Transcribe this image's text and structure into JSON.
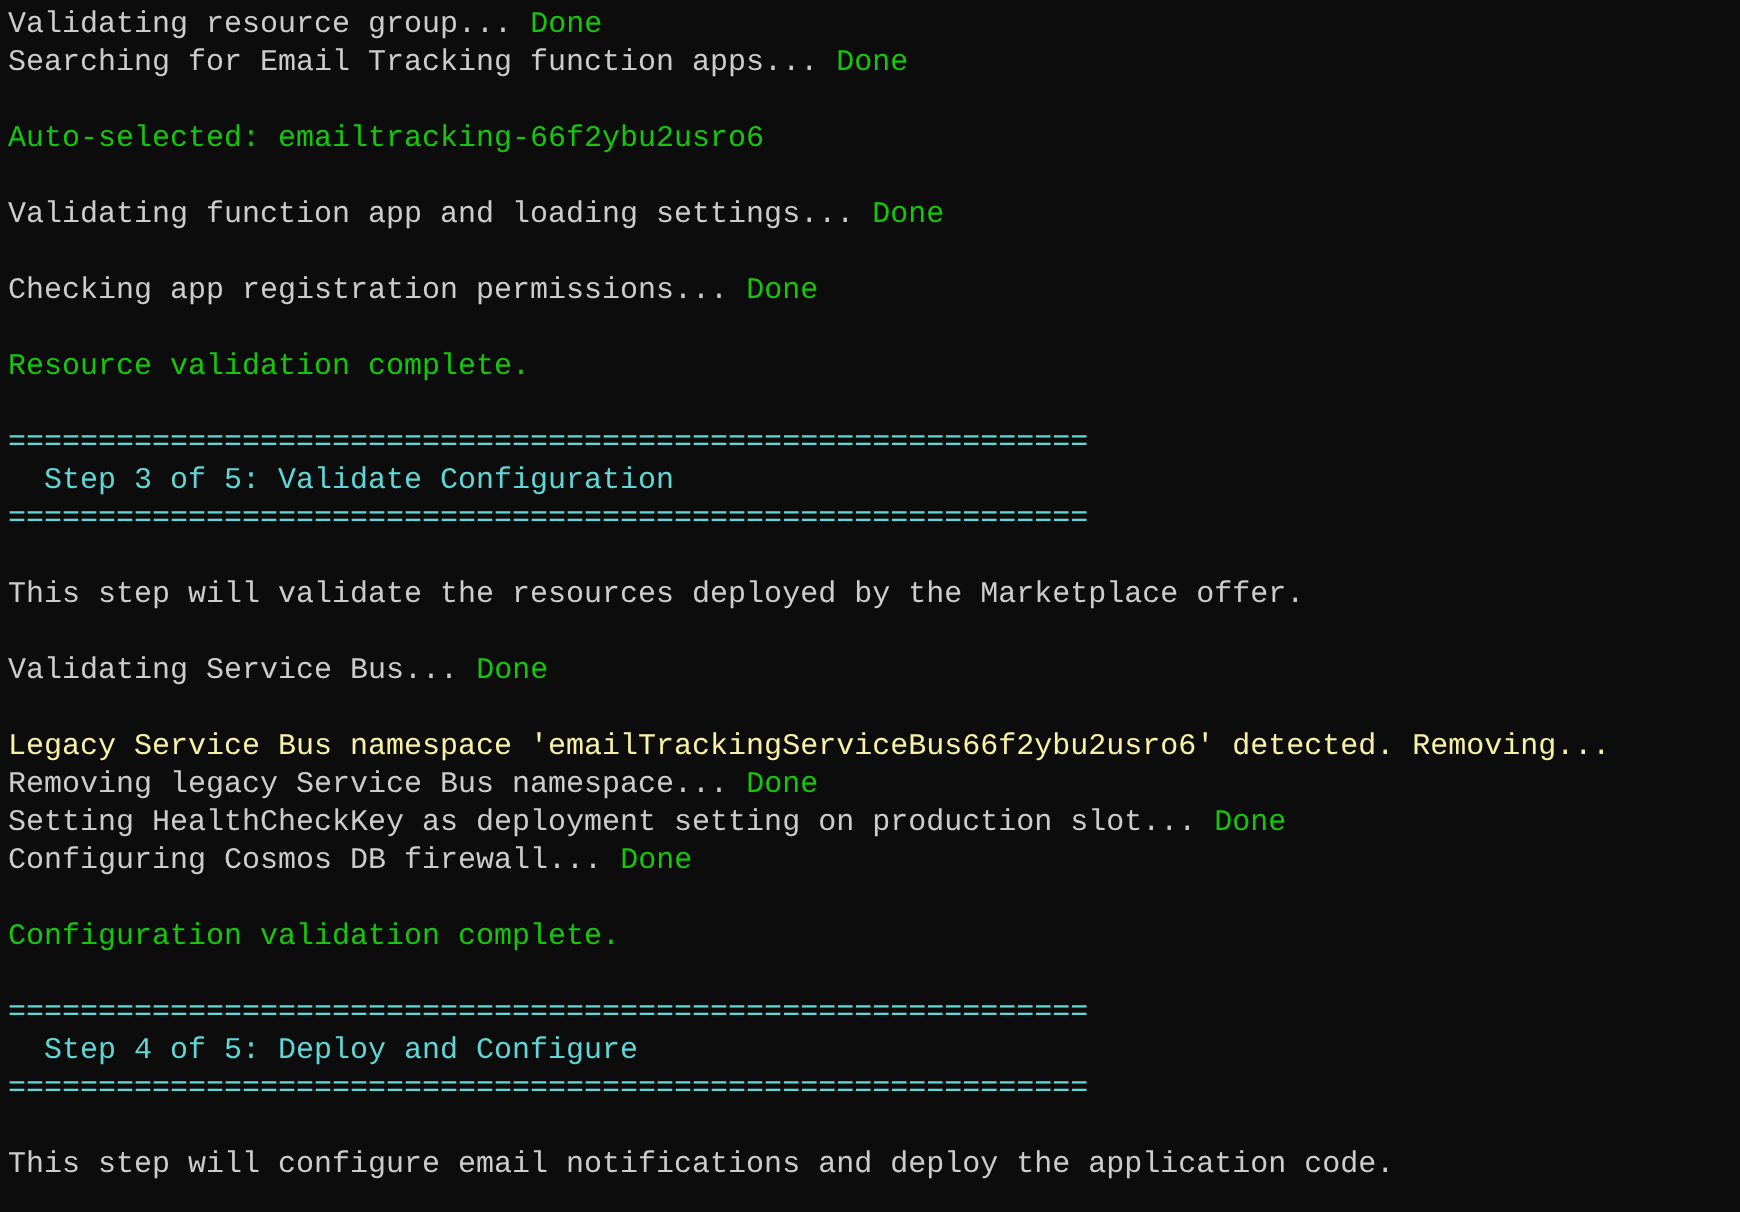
{
  "terminal": {
    "lines": [
      {
        "kind": "status",
        "text": "Validating resource group...",
        "result": "Done"
      },
      {
        "kind": "status",
        "text": "Searching for Email Tracking function apps...",
        "result": "Done"
      },
      {
        "kind": "blank"
      },
      {
        "kind": "success",
        "text": "Auto-selected: emailtracking-66f2ybu2usro6"
      },
      {
        "kind": "blank"
      },
      {
        "kind": "status",
        "text": "Validating function app and loading settings...",
        "result": "Done"
      },
      {
        "kind": "blank"
      },
      {
        "kind": "status",
        "text": "Checking app registration permissions...",
        "result": "Done"
      },
      {
        "kind": "blank"
      },
      {
        "kind": "success",
        "text": "Resource validation complete."
      },
      {
        "kind": "blank"
      },
      {
        "kind": "rule",
        "text": "============================================================"
      },
      {
        "kind": "heading",
        "text": "Step 3 of 5: Validate Configuration"
      },
      {
        "kind": "rule",
        "text": "============================================================"
      },
      {
        "kind": "blank"
      },
      {
        "kind": "plain",
        "text": "This step will validate the resources deployed by the Marketplace offer."
      },
      {
        "kind": "blank"
      },
      {
        "kind": "status",
        "text": "Validating Service Bus...",
        "result": "Done"
      },
      {
        "kind": "blank"
      },
      {
        "kind": "warning",
        "text": "Legacy Service Bus namespace 'emailTrackingServiceBus66f2ybu2usro6' detected. Removing..."
      },
      {
        "kind": "status",
        "text": "Removing legacy Service Bus namespace...",
        "result": "Done"
      },
      {
        "kind": "status",
        "text": "Setting HealthCheckKey as deployment setting on production slot...",
        "result": "Done"
      },
      {
        "kind": "status",
        "text": "Configuring Cosmos DB firewall...",
        "result": "Done"
      },
      {
        "kind": "blank"
      },
      {
        "kind": "success",
        "text": "Configuration validation complete."
      },
      {
        "kind": "blank"
      },
      {
        "kind": "rule",
        "text": "============================================================"
      },
      {
        "kind": "heading",
        "text": "Step 4 of 5: Deploy and Configure"
      },
      {
        "kind": "rule",
        "text": "============================================================"
      },
      {
        "kind": "blank"
      },
      {
        "kind": "plain",
        "text": "This step will configure email notifications and deploy the application code."
      }
    ]
  }
}
